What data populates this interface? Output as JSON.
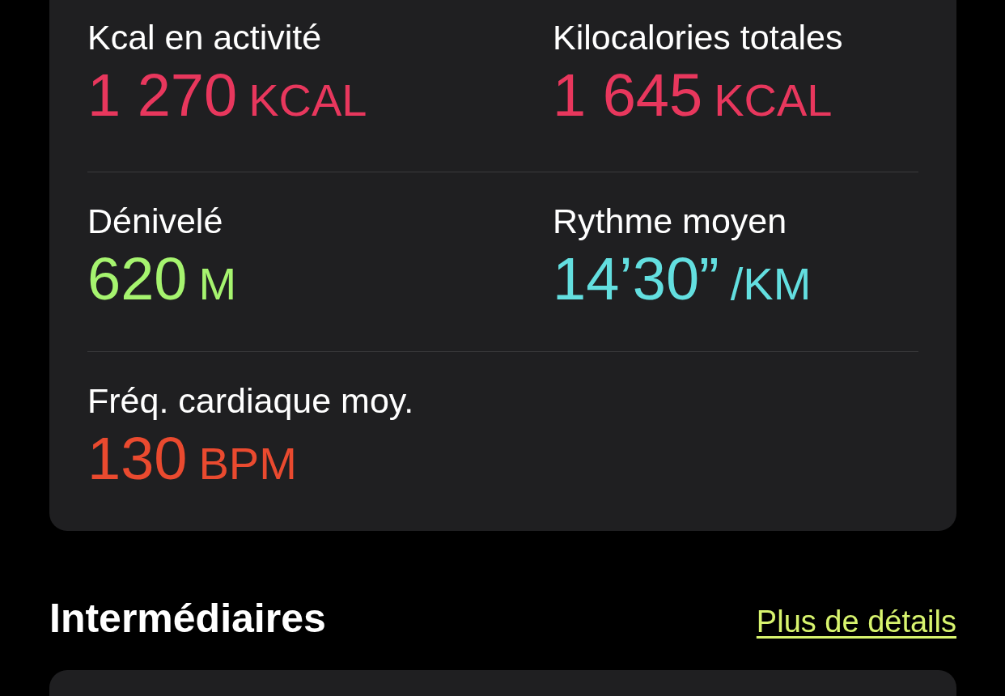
{
  "summary_card": {
    "rows": [
      {
        "metrics": [
          {
            "label": "Kcal en activité",
            "value": "1 270",
            "unit": "KCAL",
            "color": "#e8375d"
          },
          {
            "label": "Kilocalories totales",
            "value": "1 645",
            "unit": "KCAL",
            "color": "#e8375d"
          }
        ]
      },
      {
        "metrics": [
          {
            "label": "Dénivelé",
            "value": "620",
            "unit": "M",
            "color": "#a6f46f"
          },
          {
            "label": "Rythme moyen",
            "value": "14’30”",
            "unit": "/KM",
            "color": "#63dfe0"
          }
        ]
      },
      {
        "metrics": [
          {
            "label": "Fréq. cardiaque moy.",
            "value": "130",
            "unit": "BPM",
            "color": "#ea4a2f"
          }
        ]
      }
    ]
  },
  "splits_section": {
    "title": "Intermédiaires",
    "link": "Plus de détails"
  }
}
